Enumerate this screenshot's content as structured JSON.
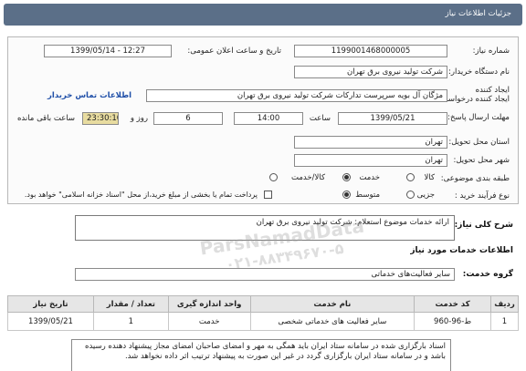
{
  "header": {
    "title": "جزئیات اطلاعات نیاز"
  },
  "form": {
    "need_number_label": "شماره نیاز:",
    "need_number": "1199001468000005",
    "announce_label": "تاریخ و ساعت اعلان عمومی:",
    "announce_value": "1399/05/14 - 12:27",
    "buyer_label": "نام دستگاه خریدار:",
    "buyer_value": "شرکت تولید نیروی برق تهران",
    "creator_label": "ایجاد کننده درخواست:",
    "creator_value": "مژگان آل بویه سرپرست تدارکات شرکت تولید نیروی برق تهران",
    "contact_link": "اطلاعات تماس خریدار",
    "deadline_label": "مهلت ارسال پاسخ: تا تاریخ:",
    "deadline_date": "1399/05/21",
    "time_label": "ساعت",
    "deadline_time": "14:00",
    "days_value": "6",
    "days_label": "روز و",
    "remaining_time": "23:30:10",
    "remaining_label": "ساعت باقی مانده",
    "province_label": "استان محل تحویل:",
    "province_value": "تهران",
    "city_label": "شهر محل تحویل:",
    "city_value": "تهران",
    "category_label": "طبقه بندی موضوعی:",
    "category_options": [
      "کالا",
      "خدمت",
      "کالا/خدمت"
    ],
    "category_selected": "خدمت",
    "process_label": "نوع فرآیند خرید :",
    "process_options": [
      "جزیی",
      "متوسط"
    ],
    "process_selected": "متوسط",
    "payment_note": "پرداخت تمام یا بخشی از مبلغ خرید،از محل \"اسناد خزانه اسلامی\" خواهد بود."
  },
  "summary": {
    "label": "شرح کلی نیاز:",
    "value": "ارائه خدمات موضوع استعلام: شرکت تولید نیروی برق تهران"
  },
  "services_info": {
    "title": "اطلاعات خدمات مورد نیاز"
  },
  "service_group": {
    "label": "گروه خدمت:",
    "value": "سایر فعالیت‌های خدماتی"
  },
  "table": {
    "headers": [
      "ردیف",
      "کد خدمت",
      "نام خدمت",
      "واحد اندازه گیری",
      "تعداد / مقدار",
      "تاریخ نیاز"
    ],
    "rows": [
      [
        "1",
        "ط-96-960",
        "سایر فعالیت های خدماتی شخصی",
        "خدمت",
        "1",
        "1399/05/21"
      ]
    ]
  },
  "note": {
    "text": "اسناد بارگزاری شده در سامانه ستاد ایران باید همگی به مهر و امضای صاحبان امضای مجاز پیشنهاد دهنده رسیده باشد و در سامانه ستاد ایران بارگزاری گردد در غیر این صورت به پیشنهاد ترتیب اثر داده نخواهد شد."
  },
  "watermark": {
    "line1": "ParsNamadData",
    "line2": "۰۲۱-۸۸۳۴۹۶۷۰-۵"
  }
}
